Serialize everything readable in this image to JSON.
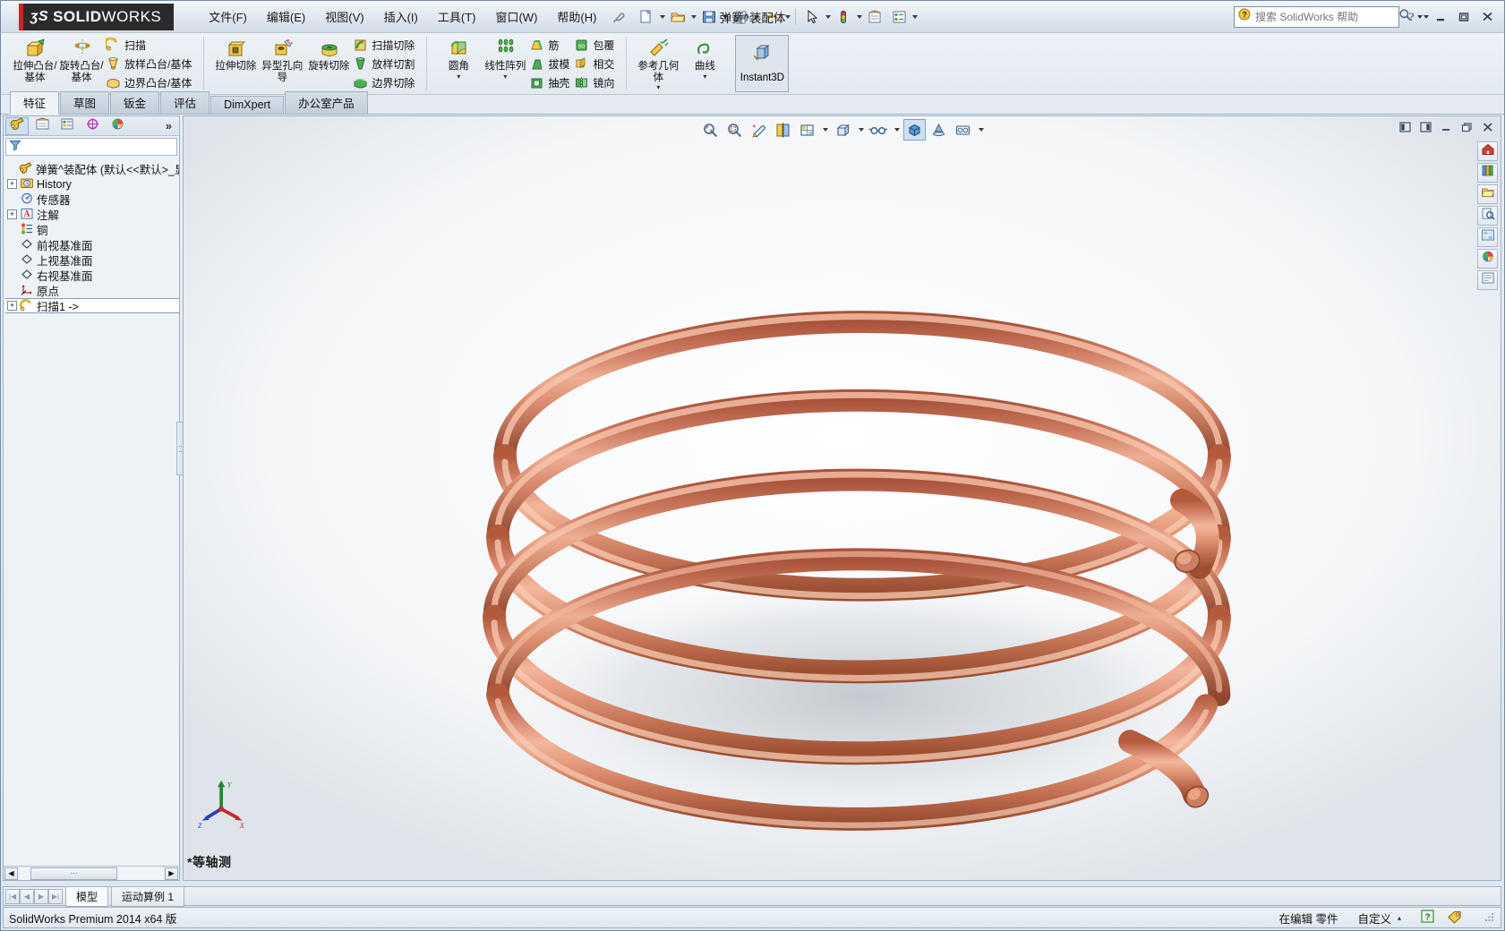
{
  "window": {
    "title": "弹簧^装配体",
    "brand_ds": "ʒS",
    "brand_solid": "SOLID",
    "brand_works": "WORKS",
    "status_version": "SolidWorks Premium 2014 x64 版"
  },
  "menubar": {
    "items": [
      {
        "label": "文件(F)",
        "name": "menu-file"
      },
      {
        "label": "编辑(E)",
        "name": "menu-edit"
      },
      {
        "label": "视图(V)",
        "name": "menu-view"
      },
      {
        "label": "插入(I)",
        "name": "menu-insert"
      },
      {
        "label": "工具(T)",
        "name": "menu-tools"
      },
      {
        "label": "窗口(W)",
        "name": "menu-window"
      },
      {
        "label": "帮助(H)",
        "name": "menu-help"
      }
    ]
  },
  "search": {
    "placeholder": "搜索 SolidWorks 帮助",
    "value": ""
  },
  "ribbon": {
    "groups": [
      {
        "name": "boss-group",
        "big": [
          {
            "label": "拉伸凸台/基体",
            "name": "extruded-boss-base",
            "icon": "extrude-boss-icon",
            "dropdown": false
          },
          {
            "label": "旋转凸台/基体",
            "name": "revolved-boss-base",
            "icon": "revolve-boss-icon",
            "dropdown": false
          }
        ],
        "small": [
          {
            "label": "扫描",
            "name": "swept-boss-base",
            "icon": "sweep-icon"
          },
          {
            "label": "放样凸台/基体",
            "name": "lofted-boss-base",
            "icon": "loft-icon"
          },
          {
            "label": "边界凸台/基体",
            "name": "boundary-boss-base",
            "icon": "boundary-icon"
          }
        ]
      },
      {
        "name": "cut-group",
        "big": [
          {
            "label": "拉伸切除",
            "name": "extruded-cut",
            "icon": "extrude-cut-icon",
            "dropdown": false
          },
          {
            "label": "异型孔向导",
            "name": "hole-wizard",
            "icon": "hole-wizard-icon",
            "dropdown": false
          },
          {
            "label": "旋转切除",
            "name": "revolved-cut",
            "icon": "revolve-cut-icon",
            "dropdown": false
          }
        ],
        "small": [
          {
            "label": "扫描切除",
            "name": "swept-cut",
            "icon": "sweep-cut-icon"
          },
          {
            "label": "放样切割",
            "name": "lofted-cut",
            "icon": "loft-cut-icon"
          },
          {
            "label": "边界切除",
            "name": "boundary-cut",
            "icon": "boundary-cut-icon"
          }
        ]
      },
      {
        "name": "feature-group",
        "big": [
          {
            "label": "圆角",
            "name": "fillet",
            "icon": "fillet-icon",
            "dropdown": true
          },
          {
            "label": "线性阵列",
            "name": "linear-pattern",
            "icon": "linear-pattern-icon",
            "dropdown": true
          }
        ],
        "small": [
          {
            "label": "筋",
            "name": "rib",
            "icon": "rib-icon"
          },
          {
            "label": "拔模",
            "name": "draft",
            "icon": "draft-icon"
          },
          {
            "label": "抽壳",
            "name": "shell",
            "icon": "shell-icon"
          }
        ],
        "small2": [
          {
            "label": "包覆",
            "name": "wrap",
            "icon": "wrap-icon"
          },
          {
            "label": "相交",
            "name": "intersect",
            "icon": "intersect-icon"
          },
          {
            "label": "镜向",
            "name": "mirror",
            "icon": "mirror-icon"
          }
        ]
      },
      {
        "name": "reference-group",
        "big": [
          {
            "label": "参考几何体",
            "name": "reference-geometry",
            "icon": "reference-geometry-icon",
            "dropdown": true
          },
          {
            "label": "曲线",
            "name": "curves",
            "icon": "curves-icon",
            "dropdown": true
          }
        ],
        "small": []
      }
    ],
    "instant3d": {
      "label": "Instant3D",
      "name": "instant3d-toggle",
      "icon": "instant3d-icon"
    }
  },
  "command_tabs": {
    "items": [
      {
        "label": "特征",
        "name": "tab-features",
        "active": true
      },
      {
        "label": "草图",
        "name": "tab-sketch",
        "active": false
      },
      {
        "label": "钣金",
        "name": "tab-sheetmetal",
        "active": false
      },
      {
        "label": "评估",
        "name": "tab-evaluate",
        "active": false
      },
      {
        "label": "DimXpert",
        "name": "tab-dimxpert",
        "active": false
      },
      {
        "label": "办公室产品",
        "name": "tab-office-products",
        "active": false
      }
    ]
  },
  "feature_manager": {
    "panel_tabs": [
      {
        "name": "featuremanager-design-tree-tab",
        "icon": "feature-tree-icon",
        "selected": true
      },
      {
        "name": "property-manager-tab",
        "icon": "property-manager-icon",
        "selected": false
      },
      {
        "name": "configuration-manager-tab",
        "icon": "configuration-manager-icon",
        "selected": false
      },
      {
        "name": "dimxpert-manager-tab",
        "icon": "dimxpert-manager-icon",
        "selected": false
      },
      {
        "name": "display-manager-tab",
        "icon": "display-manager-icon",
        "selected": false
      }
    ],
    "more_tabs_label": "»",
    "filter_placeholder": "",
    "tree": [
      {
        "label": "弹簧^装配体  (默认<<默认>_显",
        "name": "tree-root-part",
        "icon": "part-icon",
        "indent": 0,
        "expander": "none",
        "selected": false
      },
      {
        "label": "History",
        "name": "tree-item-history",
        "icon": "history-icon",
        "indent": 1,
        "expander": "+",
        "selected": false
      },
      {
        "label": "传感器",
        "name": "tree-item-sensors",
        "icon": "sensor-icon",
        "indent": 1,
        "expander": "none",
        "selected": false
      },
      {
        "label": "注解",
        "name": "tree-item-annotations",
        "icon": "annotations-icon",
        "indent": 1,
        "expander": "+",
        "selected": false
      },
      {
        "label": "铜",
        "name": "tree-item-material-copper",
        "icon": "material-icon",
        "indent": 1,
        "expander": "none",
        "selected": false
      },
      {
        "label": "前视基准面",
        "name": "tree-item-front-plane",
        "icon": "plane-icon",
        "indent": 1,
        "expander": "none",
        "selected": false
      },
      {
        "label": "上视基准面",
        "name": "tree-item-top-plane",
        "icon": "plane-icon",
        "indent": 1,
        "expander": "none",
        "selected": false
      },
      {
        "label": "右视基准面",
        "name": "tree-item-right-plane",
        "icon": "plane-icon",
        "indent": 1,
        "expander": "none",
        "selected": false
      },
      {
        "label": "原点",
        "name": "tree-item-origin",
        "icon": "origin-icon",
        "indent": 1,
        "expander": "none",
        "selected": false
      },
      {
        "label": "扫描1 ->",
        "name": "tree-item-sweep1",
        "icon": "sweep-feature-icon",
        "indent": 1,
        "expander": "+",
        "selected": true
      }
    ]
  },
  "view_toolbar": {
    "buttons": [
      {
        "name": "zoom-to-fit-button",
        "icon": "zoom-to-fit-icon",
        "caret": false,
        "active": false
      },
      {
        "name": "zoom-to-area-button",
        "icon": "zoom-to-area-icon",
        "caret": false,
        "active": false
      },
      {
        "name": "previous-view-button",
        "icon": "previous-view-icon",
        "caret": false,
        "active": false
      },
      {
        "name": "section-view-button",
        "icon": "section-view-icon",
        "caret": false,
        "active": false
      },
      {
        "name": "view-orientation-button",
        "icon": "view-orientation-icon",
        "caret": true,
        "active": false
      },
      {
        "name": "display-style-button",
        "icon": "display-style-icon",
        "caret": true,
        "active": false
      },
      {
        "name": "hide-show-items-button",
        "icon": "hide-show-items-icon",
        "caret": true,
        "active": false
      },
      {
        "name": "edit-appearance-button",
        "icon": "appearance-icon",
        "caret": false,
        "active": true
      },
      {
        "name": "apply-scene-button",
        "icon": "scene-icon",
        "caret": false,
        "active": false
      },
      {
        "name": "view-settings-button",
        "icon": "view-settings-icon",
        "caret": true,
        "active": false
      }
    ]
  },
  "graphics": {
    "view_label": "*等轴测",
    "triad": {
      "x_label": "X",
      "y_label": "Y",
      "z_label": "Z"
    },
    "model_color": "#cf7d5e",
    "model_highlight": "#f0b59a",
    "model_shadow": "#9c4f33",
    "background_color": "#ffffff"
  },
  "right_dock": {
    "buttons": [
      {
        "name": "design-library-home-button",
        "icon": "home-icon"
      },
      {
        "name": "design-library-button",
        "icon": "design-library-icon"
      },
      {
        "name": "file-explorer-button",
        "icon": "file-explorer-icon"
      },
      {
        "name": "search-library-button",
        "icon": "search-library-icon"
      },
      {
        "name": "view-palette-button",
        "icon": "view-palette-icon"
      },
      {
        "name": "appearances-scenes-button",
        "icon": "appearances-icon"
      },
      {
        "name": "custom-properties-button",
        "icon": "custom-properties-icon"
      }
    ]
  },
  "document_tabs": {
    "nav_buttons": [
      {
        "name": "first-tab-button",
        "glyph": "|◀"
      },
      {
        "name": "prev-tab-button",
        "glyph": "◀"
      },
      {
        "name": "next-tab-button",
        "glyph": "▶"
      },
      {
        "name": "last-tab-button",
        "glyph": "▶|"
      }
    ],
    "tabs": [
      {
        "label": "模型",
        "name": "doc-tab-model",
        "active": true
      },
      {
        "label": "运动算例 1",
        "name": "doc-tab-motion-study-1",
        "active": false
      }
    ]
  },
  "status_bar": {
    "left": "SolidWorks Premium 2014 x64 版",
    "editing": "在编辑 零件",
    "custom": "自定义",
    "help_glyph": "?"
  },
  "window_buttons": {
    "help": "?",
    "minimize": "—",
    "restore": "❐",
    "close": "✕"
  },
  "gfx_window_buttons": {
    "restore_left": "◧",
    "restore_right": "◨",
    "minimize": "—",
    "maximize": "❐",
    "close": "✕"
  }
}
